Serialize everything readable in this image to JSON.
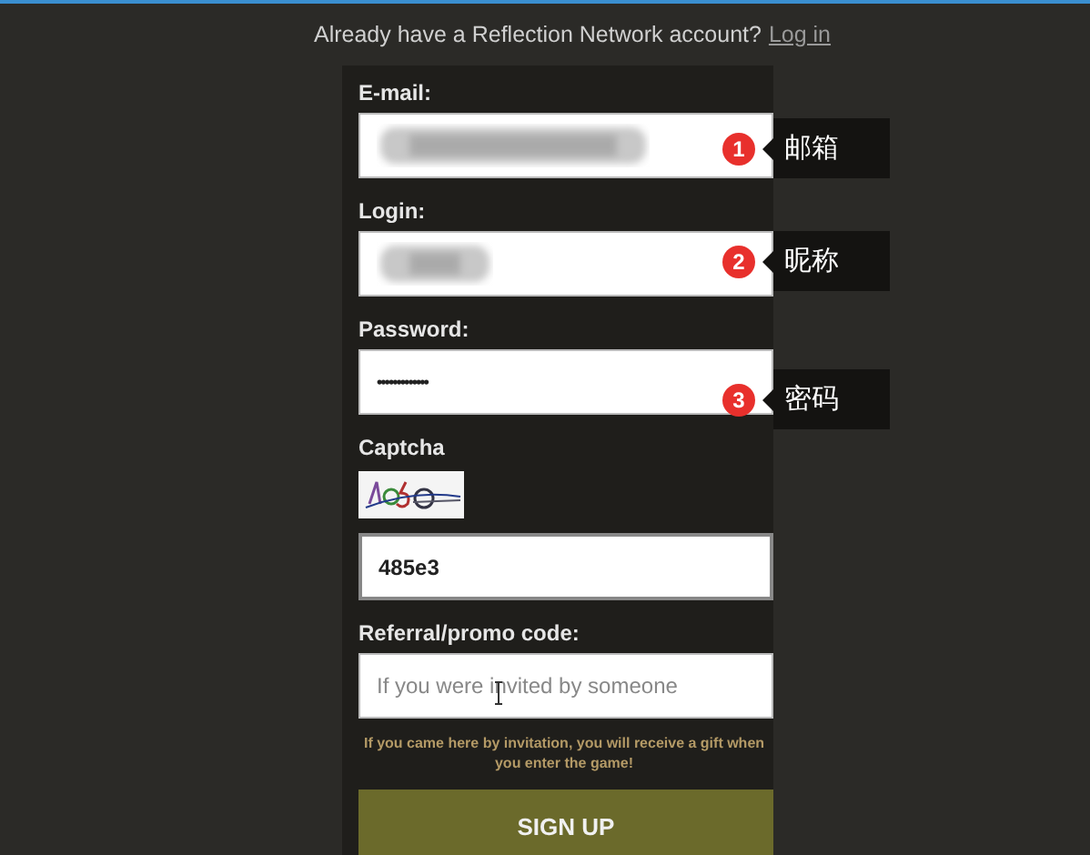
{
  "header": {
    "text": "Already have a Reflection Network account?",
    "link": "Log in"
  },
  "fields": [
    {
      "label": "E-mail:",
      "kind": "blurred",
      "annotation": {
        "number": "1",
        "text": "邮箱"
      }
    },
    {
      "label": "Login:",
      "kind": "blurred",
      "annotation": {
        "number": "2",
        "text": "昵称"
      }
    },
    {
      "label": "Password:",
      "kind": "password",
      "value": "•••••••••••••",
      "annotation": {
        "number": "3",
        "text": "密码"
      }
    },
    {
      "label": "Captcha",
      "kind": "captcha",
      "value": "485e3"
    },
    {
      "label": "Referral/promo code:",
      "kind": "text",
      "placeholder": "If you were invited by someone"
    }
  ],
  "note": "If you came here by invitation, you will receive a gift when you enter the game!",
  "button": "SIGN UP"
}
